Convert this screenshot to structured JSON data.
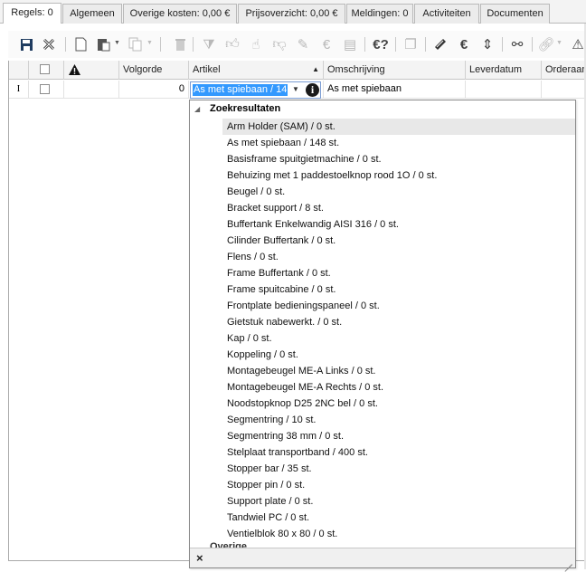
{
  "tabs": [
    {
      "label": "Regels: 0"
    },
    {
      "label": "Algemeen"
    },
    {
      "label": "Overige kosten: 0,00 €"
    },
    {
      "label": "Prijsoverzicht: 0,00 €"
    },
    {
      "label": "Meldingen: 0"
    },
    {
      "label": "Activiteiten"
    },
    {
      "label": "Documenten"
    }
  ],
  "toolbar": {
    "icons": [
      "save-icon",
      "cancel-icon",
      "new-document-icon",
      "paste-icon",
      "copy-icon",
      "delete-icon",
      "filter-icon",
      "thumbs-up-icon",
      "thumbs-up-check-icon",
      "thumbs-down-icon",
      "document-edit-icon",
      "document-money-icon",
      "document-table-icon",
      "help-euro-icon",
      "document-copy-icon",
      "tape-icon",
      "euro-wrench-icon",
      "resize-arrows-icon",
      "link-tools-icon",
      "link-icon",
      "warning-icon"
    ]
  },
  "grid": {
    "headers": {
      "warning_icon": "warning-icon",
      "volgorde": "Volgorde",
      "artikel": "Artikel",
      "omschrijving": "Omschrijving",
      "leverdatum": "Leverdatum",
      "orderaantal": "Orderaan"
    },
    "sort_arrow": "▲",
    "row": {
      "cursor": "I",
      "volgorde": "0",
      "artikel_value": "As met spiebaan /  14",
      "omschrijving": "As met spiebaan"
    }
  },
  "dropdown": {
    "group_label": "Zoekresultaten",
    "second_group_partial": "Overige",
    "items": [
      "Arm Holder (SAM) /  0 st.",
      "As met spiebaan /  148 st.",
      "Basisframe spuitgietmachine /  0 st.",
      "Behuizing met 1 paddestoelknop rood 1O /  0 st.",
      "Beugel /  0 st.",
      "Bracket support /  8 st.",
      "Buffertank Enkelwandig AISI 316 /  0 st.",
      "Cilinder Buffertank /  0 st.",
      "Flens /  0 st.",
      "Frame Buffertank /  0 st.",
      "Frame spuitcabine /  0 st.",
      "Frontplate bedieningspaneel /  0 st.",
      "Gietstuk nabewerkt. /  0 st.",
      "Kap /  0 st.",
      "Koppeling /  0 st.",
      "Montagebeugel ME-A Links /  0 st.",
      "Montagebeugel ME-A Rechts /  0 st.",
      "Noodstopknop D25 2NC bel /  0 st.",
      "Segmentring /  10 st.",
      "Segmentring 38 mm /  0 st.",
      "Stelplaat transportband /  400 st.",
      "Stopper bar /  35 st.",
      "Stopper pin /  0 st.",
      "Support plate /  0 st.",
      "Tandwiel PC /  0 st.",
      "Ventielblok 80 x 80 /  0 st."
    ],
    "highlighted_index": 0,
    "close_label": "×"
  }
}
